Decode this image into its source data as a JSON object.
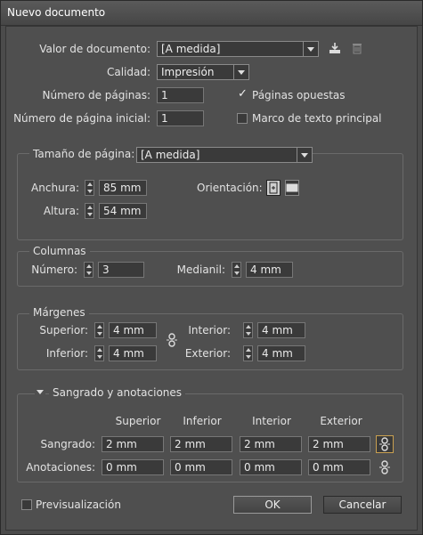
{
  "window": {
    "title": "Nuevo documento"
  },
  "doc": {
    "preset_label": "Valor de documento:",
    "preset_value": "[A medida]",
    "quality_label": "Calidad:",
    "quality_value": "Impresión",
    "pages_label": "Número de páginas:",
    "pages_value": "1",
    "start_label": "Número de página inicial:",
    "start_value": "1",
    "facing_label": "Páginas opuestas",
    "facing_checked": true,
    "master_label": "Marco de texto principal",
    "master_checked": false
  },
  "page_size": {
    "title": "Tamaño de página:",
    "value": "[A medida]",
    "width_label": "Anchura:",
    "width_value": "85 mm",
    "height_label": "Altura:",
    "height_value": "54 mm",
    "orientation_label": "Orientación:"
  },
  "columns": {
    "title": "Columnas",
    "number_label": "Número:",
    "number_value": "3",
    "gutter_label": "Medianil:",
    "gutter_value": "4 mm"
  },
  "margins": {
    "title": "Márgenes",
    "top_label": "Superior:",
    "top_value": "4 mm",
    "bottom_label": "Inferior:",
    "bottom_value": "4 mm",
    "inside_label": "Interior:",
    "inside_value": "4 mm",
    "outside_label": "Exterior:",
    "outside_value": "4 mm"
  },
  "bleed": {
    "title": "Sangrado y anotaciones",
    "headers": [
      "Superior",
      "Inferior",
      "Interior",
      "Exterior"
    ],
    "bleed_label": "Sangrado:",
    "bleed_values": [
      "2 mm",
      "2 mm",
      "2 mm",
      "2 mm"
    ],
    "slug_label": "Anotaciones:",
    "slug_values": [
      "0 mm",
      "0 mm",
      "0 mm",
      "0 mm"
    ]
  },
  "footer": {
    "preview_label": "Previsualización",
    "ok": "OK",
    "cancel": "Cancelar"
  }
}
